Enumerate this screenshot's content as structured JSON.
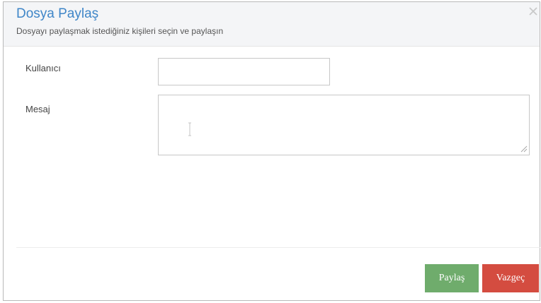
{
  "dialog": {
    "title": "Dosya Paylaş",
    "subtitle": "Dosyayı paylaşmak istediğiniz kişileri seçin ve paylaşın",
    "close_icon": "close-icon"
  },
  "form": {
    "user_label": "Kullanıcı",
    "user_value": "",
    "message_label": "Mesaj",
    "message_value": ""
  },
  "buttons": {
    "share_label": "Paylaş",
    "cancel_label": "Vazgeç"
  },
  "colors": {
    "title": "#3f86c8",
    "header_bg": "#f4f5f7",
    "share_button": "#6fac6c",
    "cancel_button": "#d44c40"
  }
}
